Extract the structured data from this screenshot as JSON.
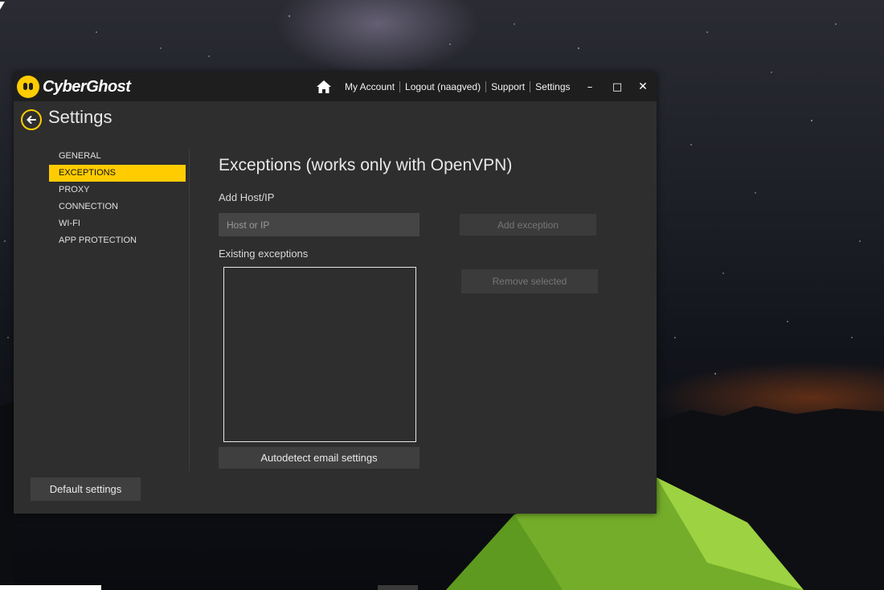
{
  "window": {
    "logo_text": "CyberGhost",
    "page_title": "Settings"
  },
  "top_nav": {
    "links": [
      "My Account",
      "Logout (naagved)",
      "Support",
      "Settings"
    ]
  },
  "window_controls": {
    "minimize": "–",
    "maximize": "□",
    "close": "✕"
  },
  "sidebar": {
    "items": [
      {
        "label": "GENERAL",
        "active": false
      },
      {
        "label": "EXCEPTIONS",
        "active": true
      },
      {
        "label": "PROXY",
        "active": false
      },
      {
        "label": "CONNECTION",
        "active": false
      },
      {
        "label": "WI-FI",
        "active": false
      },
      {
        "label": "APP PROTECTION",
        "active": false
      }
    ]
  },
  "exceptions": {
    "title": "Exceptions (works only with OpenVPN)",
    "add_label": "Add Host/IP",
    "host_placeholder": "Host or IP",
    "host_value": "",
    "add_button": "Add exception",
    "existing_label": "Existing exceptions",
    "existing_items": [],
    "remove_button": "Remove selected",
    "autodetect_button": "Autodetect email settings"
  },
  "footer": {
    "default_button": "Default settings"
  },
  "colors": {
    "accent": "#ffcc00",
    "window_bg": "#2e2e2e",
    "titlebar_bg": "#1e1e1e"
  },
  "icons": {
    "home": "home-icon",
    "back": "back-arrow-icon",
    "logo": "cyberghost-logo-icon"
  }
}
